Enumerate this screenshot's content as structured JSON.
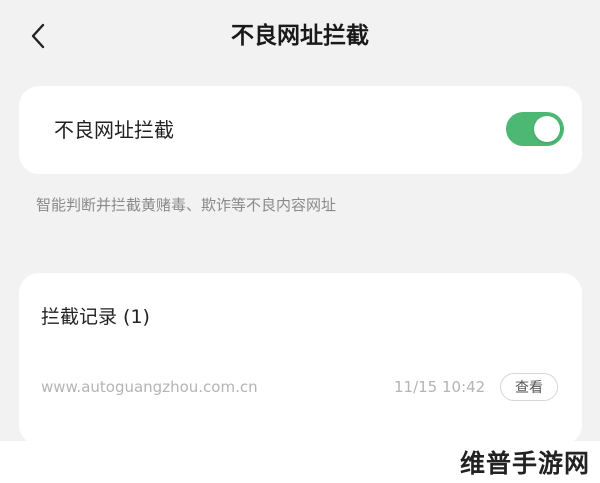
{
  "header": {
    "title": "不良网址拦截",
    "back_icon": "chevron-left-icon"
  },
  "toggle": {
    "label": "不良网址拦截",
    "enabled": true,
    "accent_color": "#4cb874"
  },
  "description": "智能判断并拦截黄赌毒、欺诈等不良内容网址",
  "records": {
    "title": "拦截记录 (1)",
    "items": [
      {
        "url": "www.autoguangzhou.com.cn",
        "time": "11/15 10:42",
        "action_label": "查看"
      }
    ]
  },
  "watermark": "维普手游网"
}
